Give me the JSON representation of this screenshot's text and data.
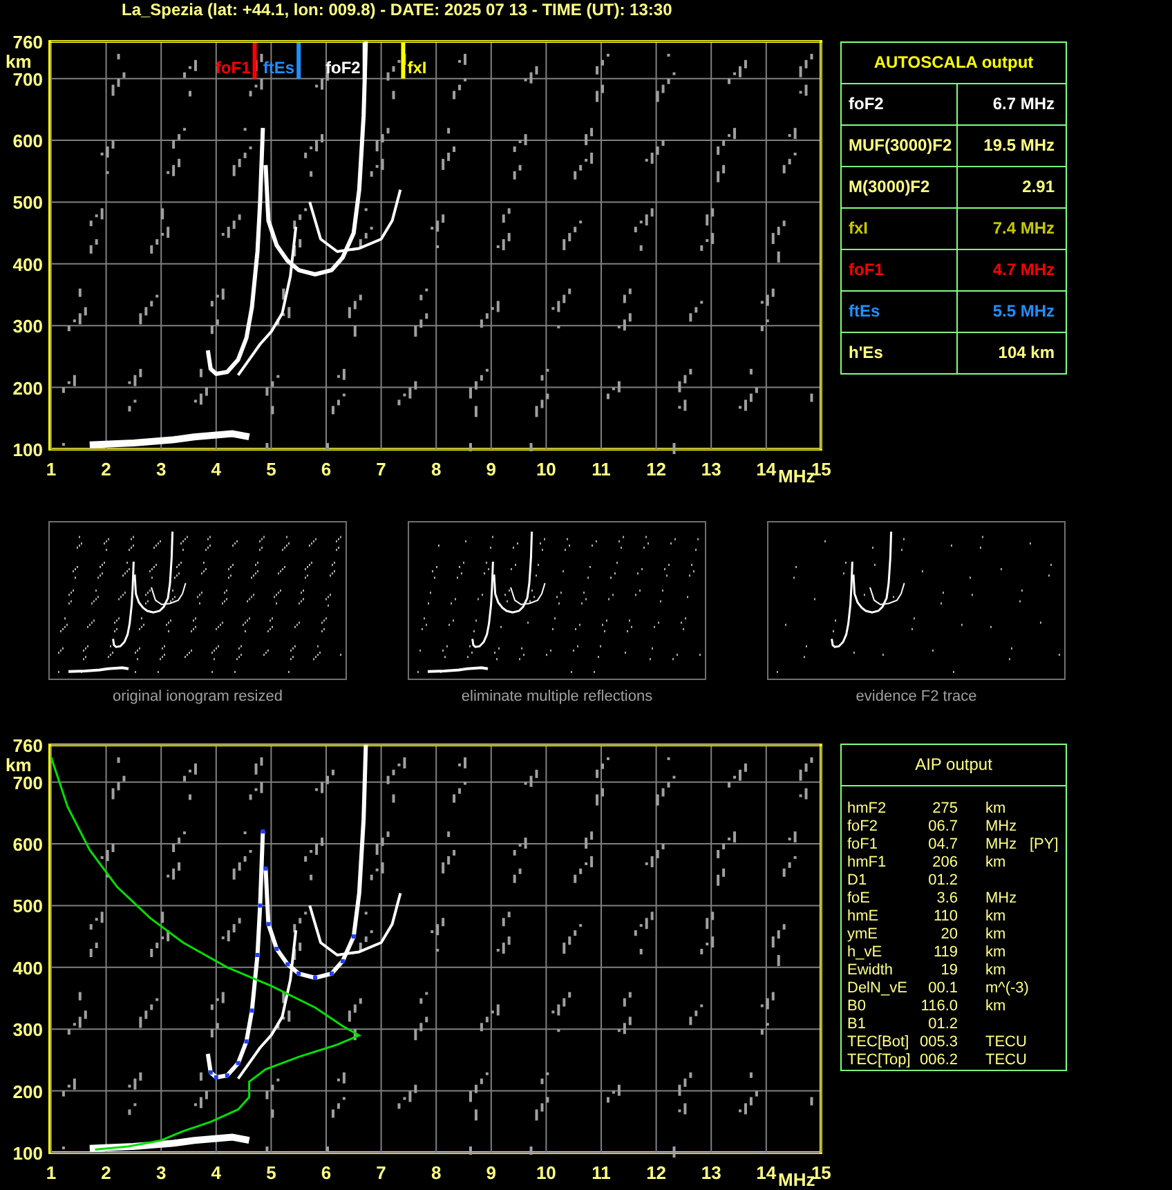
{
  "title": "La_Spezia (lat: +44.1, lon: 009.8) - DATE: 2025 07 13 - TIME (UT): 13:30",
  "top_plot": {
    "y_labels": [
      "760",
      "700",
      "600",
      "500",
      "400",
      "300",
      "200",
      "100"
    ],
    "y_unit": "km",
    "x_labels": [
      "1",
      "2",
      "3",
      "4",
      "5",
      "6",
      "7",
      "8",
      "9",
      "10",
      "11",
      "12",
      "13",
      "14",
      "15"
    ],
    "x_unit": "MHz",
    "markers": [
      {
        "label": "foF1",
        "color": "#ff0000"
      },
      {
        "label": "ftEs",
        "color": "#1e90ff"
      },
      {
        "label": "foF2",
        "color": "#ffffff"
      },
      {
        "label": "fxI",
        "color": "#ffff00"
      }
    ]
  },
  "autoscala": {
    "title": "AUTOSCALA output",
    "rows": [
      {
        "name": "foF2",
        "value": "6.7 MHz",
        "color": "#ffffff"
      },
      {
        "name": "MUF(3000)F2",
        "value": "19.5 MHz",
        "color": "#ffff80"
      },
      {
        "name": "M(3000)F2",
        "value": "2.91",
        "color": "#ffff80"
      },
      {
        "name": "fxI",
        "value": "7.4 MHz",
        "color": "#c8c800"
      },
      {
        "name": "foF1",
        "value": "4.7 MHz",
        "color": "#ff0000"
      },
      {
        "name": "ftEs",
        "value": "5.5 MHz",
        "color": "#1e90ff"
      },
      {
        "name": "h'Es",
        "value": "104 km",
        "color": "#ffff80"
      }
    ]
  },
  "thumbnails": [
    {
      "kind": "original",
      "caption": "original ionogram resized"
    },
    {
      "kind": "filtered",
      "caption": "eliminate multiple reflections"
    },
    {
      "kind": "trace",
      "caption": "evidence F2 trace"
    }
  ],
  "bottom_plot": {
    "y_labels": [
      "760",
      "700",
      "600",
      "500",
      "400",
      "300",
      "200",
      "100"
    ],
    "y_unit": "km",
    "x_labels": [
      "1",
      "2",
      "3",
      "4",
      "5",
      "6",
      "7",
      "8",
      "9",
      "10",
      "11",
      "12",
      "13",
      "14",
      "15"
    ],
    "x_unit": "MHz"
  },
  "aip": {
    "title": "AIP output",
    "rows": [
      {
        "name": "hmF2",
        "value": "275",
        "unit": "km"
      },
      {
        "name": "foF2",
        "value": "06.7",
        "unit": "MHz"
      },
      {
        "name": "foF1",
        "value": "04.7",
        "unit": "MHz",
        "note": "[PY]"
      },
      {
        "name": "hmF1",
        "value": "206",
        "unit": "km"
      },
      {
        "name": "D1",
        "value": "01.2"
      },
      {
        "name": "foE",
        "value": "3.6",
        "unit": "MHz"
      },
      {
        "name": "hmE",
        "value": "110",
        "unit": "km"
      },
      {
        "name": "ymE",
        "value": "20",
        "unit": "km"
      },
      {
        "name": "h_vE",
        "value": "119",
        "unit": "km"
      },
      {
        "name": "Ewidth",
        "value": "19",
        "unit": "km"
      },
      {
        "name": "DelN_vE",
        "value": "00.1",
        "unit": "m^(-3)"
      },
      {
        "name": "B0",
        "value": "116.0",
        "unit": "km"
      },
      {
        "name": "B1",
        "value": "01.2"
      },
      {
        "name": "TEC[Bot]",
        "value": "005.3",
        "unit": "TECU"
      },
      {
        "name": "TEC[Top]",
        "value": "006.2",
        "unit": "TECU"
      }
    ]
  }
}
